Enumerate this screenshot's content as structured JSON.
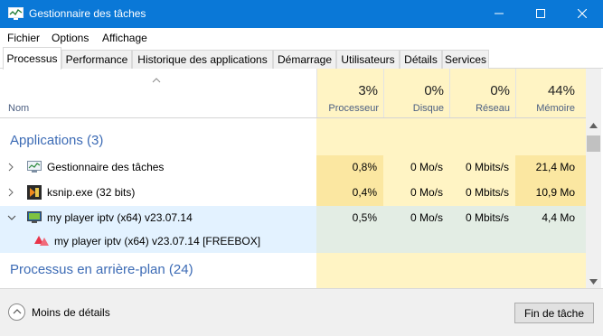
{
  "window": {
    "title": "Gestionnaire des tâches"
  },
  "menu": {
    "items": [
      "Fichier",
      "Options",
      "Affichage"
    ]
  },
  "tabs": [
    "Processus",
    "Performance",
    "Historique des applications",
    "Démarrage",
    "Utilisateurs",
    "Détails",
    "Services"
  ],
  "header": {
    "name_label": "Nom",
    "columns": [
      {
        "pct": "3%",
        "label": "Processeur"
      },
      {
        "pct": "0%",
        "label": "Disque"
      },
      {
        "pct": "0%",
        "label": "Réseau"
      },
      {
        "pct": "44%",
        "label": "Mémoire"
      }
    ]
  },
  "groups": {
    "apps": "Applications (3)",
    "background": "Processus en arrière-plan (24)"
  },
  "rows": [
    {
      "name": "Gestionnaire des tâches",
      "icon": "task-manager-icon",
      "cpu": "0,8%",
      "disk": "0 Mo/s",
      "net": "0 Mbits/s",
      "mem": "21,4 Mo"
    },
    {
      "name": "ksnip.exe (32 bits)",
      "icon": "ksnip-icon",
      "cpu": "0,4%",
      "disk": "0 Mo/s",
      "net": "0 Mbits/s",
      "mem": "10,9 Mo"
    },
    {
      "name": "my player iptv (x64) v23.07.14",
      "icon": "player-icon",
      "cpu": "0,5%",
      "disk": "0 Mo/s",
      "net": "0 Mbits/s",
      "mem": "4,4 Mo"
    }
  ],
  "child_row": {
    "name": "my player iptv (x64) v23.07.14 [FREEBOX]",
    "icon": "freebox-icon"
  },
  "footer": {
    "fewer_details": "Moins de détails",
    "end_task": "Fin de tâche"
  },
  "colors": {
    "titlebar": "#0a78d7",
    "heat_light": "#fff4c4",
    "heat_strong": "#fbe7a1",
    "selection": "#cce8ff",
    "group_text": "#3c6bb5"
  }
}
